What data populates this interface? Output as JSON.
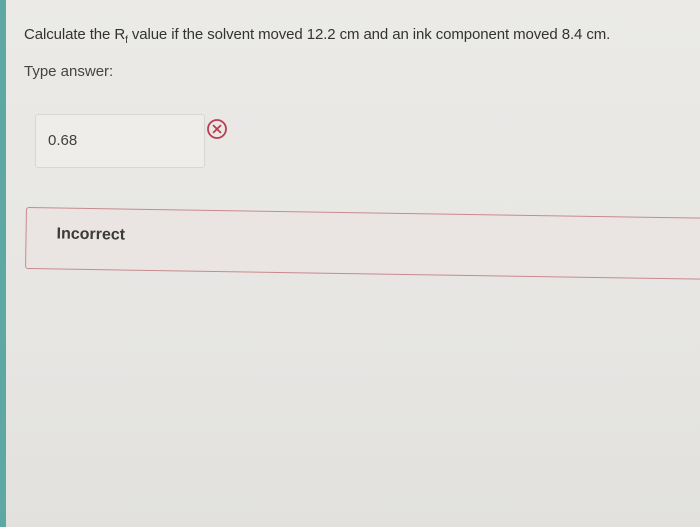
{
  "question": {
    "prefix": "Calculate the R",
    "subscript": "f",
    "suffix": " value if the solvent moved 12.2 cm and an ink component moved 8.4 cm."
  },
  "prompt_label": "Type answer:",
  "answer": {
    "value": "0.68"
  },
  "status": {
    "icon": "x-circle-icon",
    "color": "#b93e52"
  },
  "feedback": {
    "label": "Incorrect"
  }
}
